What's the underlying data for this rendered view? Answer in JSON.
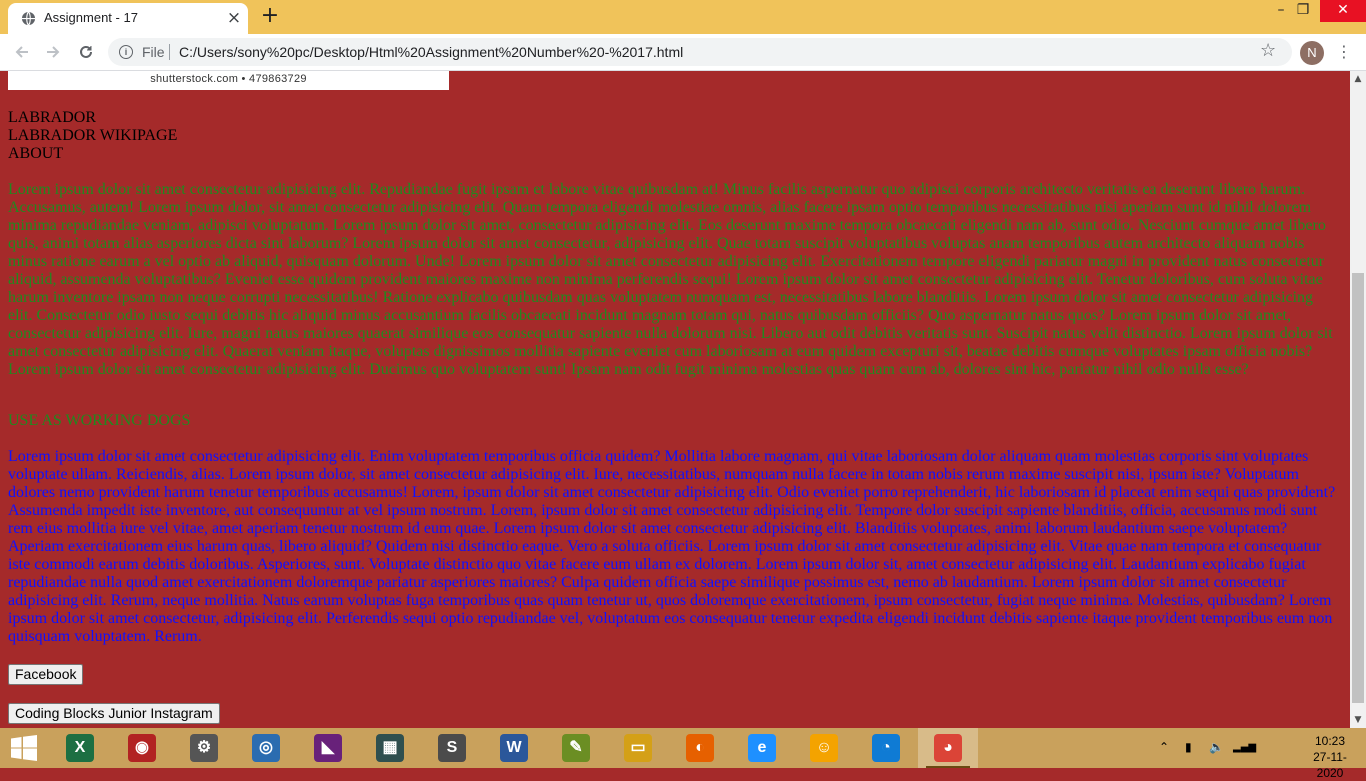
{
  "browser": {
    "tab_title": "Assignment - 17",
    "close_glyph": "×",
    "new_tab_glyph": "+",
    "address_scheme_label": "File",
    "url": "C:/Users/sony%20pc/Desktop/Html%20Assignment%20Number%20-%2017.html",
    "avatar_letter": "N",
    "window_controls": {
      "minimize": "–",
      "maximize": "❐",
      "close": "✕"
    },
    "icons": {
      "back": "arrow-left-icon",
      "forward": "arrow-right-icon",
      "reload": "reload-icon",
      "info": "info-icon",
      "star": "star-icon",
      "menu": "kebab-menu-icon"
    }
  },
  "page": {
    "image_caption": "shutterstock.com • 479863729",
    "nav_links": [
      "LABRADOR",
      "LABRADOR WIKIPAGE",
      "ABOUT"
    ],
    "about_text": "Lorem ipsum dolor sit amet consectetur adipisicing elit. Repudiandae fugit ipsam et labore vitae quibusdam at! Minus facilis aspernatur quo adipisci corporis architecto veritatis ea deserunt libero harum. Accusamus, autem! Lorem ipsum dolor, sit amet consectetur adipisicing elit. Quam tempora eligendi molestiae omnis, alias facere ipsam optio temporibus necessitatibus nisi aperiam sunt id nihil dolorem minima repudiandae veniam, adipisci voluptatum. Lorem ipsum dolor sit amet, consectetur adipisicing elit. Eos deserunt maxime tempora obcaecati eligendi nam ab, sunt odio. Nesciunt cumque amet libero quis, animi totam alias asperiores dicta sint laborum? Lorem ipsum dolor sit amet consectetur, adipisicing elit. Quae totam suscipit voluptatibus voluptas anam temporibus autem architecto aliquam nobis minus ratione earum a vel optio ab aliquid, quisquam dolorum. Unde! Lorem ipsum dolor sit amet consectetur adipisicing elit. Exercitationem tempore eligendi pariatur magni in provident natus consectetur aliquid, assumenda voluptatibus? Eveniet esse quidem provident maiores maxime non minima perferendis sequi! Lorem ipsum dolor sit amet consectetur adipisicing elit. Tenetur doloribus, cum soluta vitae harum inventore ipsam non neque corrupti necessitatibus! Ratione explicabo quibusdam quas voluptatem numquam est, necessitatibus labore blanditiis. Lorem ipsum dolor sit amet consectetur adipisicing elit. Consectetur odio iusto sequi debitis hic aliquid minus accusantium facilis obcaecati incidunt magnam totam qui, natus quibusdam officiis? Quo aspernatur natus quos? Lorem ipsum dolor sit amet, consectetur adipisicing elit. Iure, magni natus maiores quaerat similique eos consequatur sapiente nulla dolorum nisi. Libero aut odit debitis veritatis sunt. Suscipit natus velit distinctio. Lorem ipsum dolor sit amet consectetur adipisicing elit. Quaerat veniam itaque, voluptas dignissimos mollitia sapiente eveniet cum laboriosam at eum quidem excepturi sit, beatae debitis cumque voluptates ipsam officia nobis? Lorem ipsum dolor sit amet consectetur adipisicing elit. Ducimus quo voluptatem sunt! Ipsam nam odit fugit minima molestias quas quam cum ab, dolores sint hic, pariatur nihil odio nulla esse?",
    "dogs_heading": "USE AS WORKING DOGS",
    "dogs_text": "Lorem ipsum dolor sit amet consectetur adipisicing elit. Enim voluptatem temporibus officia quidem? Mollitia labore magnam, qui vitae laboriosam dolor aliquam quam molestias corporis sint voluptates voluptate ullam. Reiciendis, alias. Lorem ipsum dolor, sit amet consectetur adipisicing elit. Iure, necessitatibus, numquam nulla facere in totam nobis rerum maxime suscipit nisi, ipsum iste? Voluptatum dolores nemo provident harum tenetur temporibus accusamus! Lorem, ipsum dolor sit amet consectetur adipisicing elit. Odio eveniet porro reprehenderit, hic laboriosam id placeat enim sequi quas provident? Assumenda impedit iste inventore, aut consequuntur at vel ipsum nostrum. Lorem, ipsum dolor sit amet consectetur adipisicing elit. Tempore dolor suscipit sapiente blanditiis, officia, accusamus modi sunt rem eius mollitia iure vel vitae, amet aperiam tenetur nostrum id eum quae. Lorem ipsum dolor sit amet consectetur adipisicing elit. Blanditiis voluptates, animi laborum laudantium saepe voluptatem? Aperiam exercitationem eius harum quas, libero aliquid? Quidem nisi distinctio eaque. Vero a soluta officiis. Lorem ipsum dolor sit amet consectetur adipisicing elit. Vitae quae nam tempora et consequatur iste commodi earum debitis doloribus. Asperiores, sunt. Voluptate distinctio quo vitae facere eum ullam ex dolorem. Lorem ipsum dolor sit, amet consectetur adipisicing elit. Laudantium explicabo fugiat repudiandae nulla quod amet exercitationem doloremque pariatur asperiores maiores? Culpa quidem officia saepe similique possimus est, nemo ab laudantium. Lorem ipsum dolor sit amet consectetur adipisicing elit. Rerum, neque mollitia. Natus earum voluptas fuga temporibus quas quam tenetur ut, quos doloremque exercitationem, ipsum consectetur, fugiat neque minima. Molestias, quibusdam? Lorem ipsum dolor sit amet consectetur, adipisicing elit. Perferendis sequi optio repudiandae vel, voluptatum eos consequatur tenetur expedita eligendi incidunt debitis sapiente itaque provident temporibus eum non quisquam voluptatem. Rerum.",
    "buttons": {
      "facebook": "Facebook",
      "instagram": "Coding Blocks Junior Instagram"
    },
    "colors": {
      "background": "#a52a2a",
      "about_text": "#1f8a1f",
      "dogs_text": "#1010ff"
    }
  },
  "taskbar": {
    "apps": [
      {
        "name": "excel-icon",
        "glyph": "X",
        "color": "#1d6f42"
      },
      {
        "name": "recorder-icon",
        "glyph": "◉",
        "color": "#b22222"
      },
      {
        "name": "scanner-icon",
        "glyph": "⚙",
        "color": "#555555"
      },
      {
        "name": "disc-icon",
        "glyph": "◎",
        "color": "#2b6cb0"
      },
      {
        "name": "visual-studio-icon",
        "glyph": "◣",
        "color": "#68217a"
      },
      {
        "name": "video-icon",
        "glyph": "▦",
        "color": "#2f4f4f"
      },
      {
        "name": "sublime-icon",
        "glyph": "S",
        "color": "#4b4b4b"
      },
      {
        "name": "word-icon",
        "glyph": "W",
        "color": "#2b579a"
      },
      {
        "name": "paint-icon",
        "glyph": "✎",
        "color": "#6b8e23"
      },
      {
        "name": "file-explorer-icon",
        "glyph": "▭",
        "color": "#d4a017"
      },
      {
        "name": "firefox-icon",
        "glyph": "◐",
        "color": "#e66000"
      },
      {
        "name": "internet-explorer-icon",
        "glyph": "e",
        "color": "#1e90ff"
      },
      {
        "name": "scratch-icon",
        "glyph": "☺",
        "color": "#f4a300"
      },
      {
        "name": "edge-icon",
        "glyph": "◔",
        "color": "#0f7bd4"
      },
      {
        "name": "chrome-icon",
        "glyph": "◕",
        "color": "#db4437",
        "active": true
      }
    ],
    "tray_glyphs": {
      "chevron": "⌃",
      "battery": "▮",
      "volume": "🔈",
      "signal": "▂▄▆"
    },
    "time": "10:23",
    "date": "27-11-2020"
  }
}
